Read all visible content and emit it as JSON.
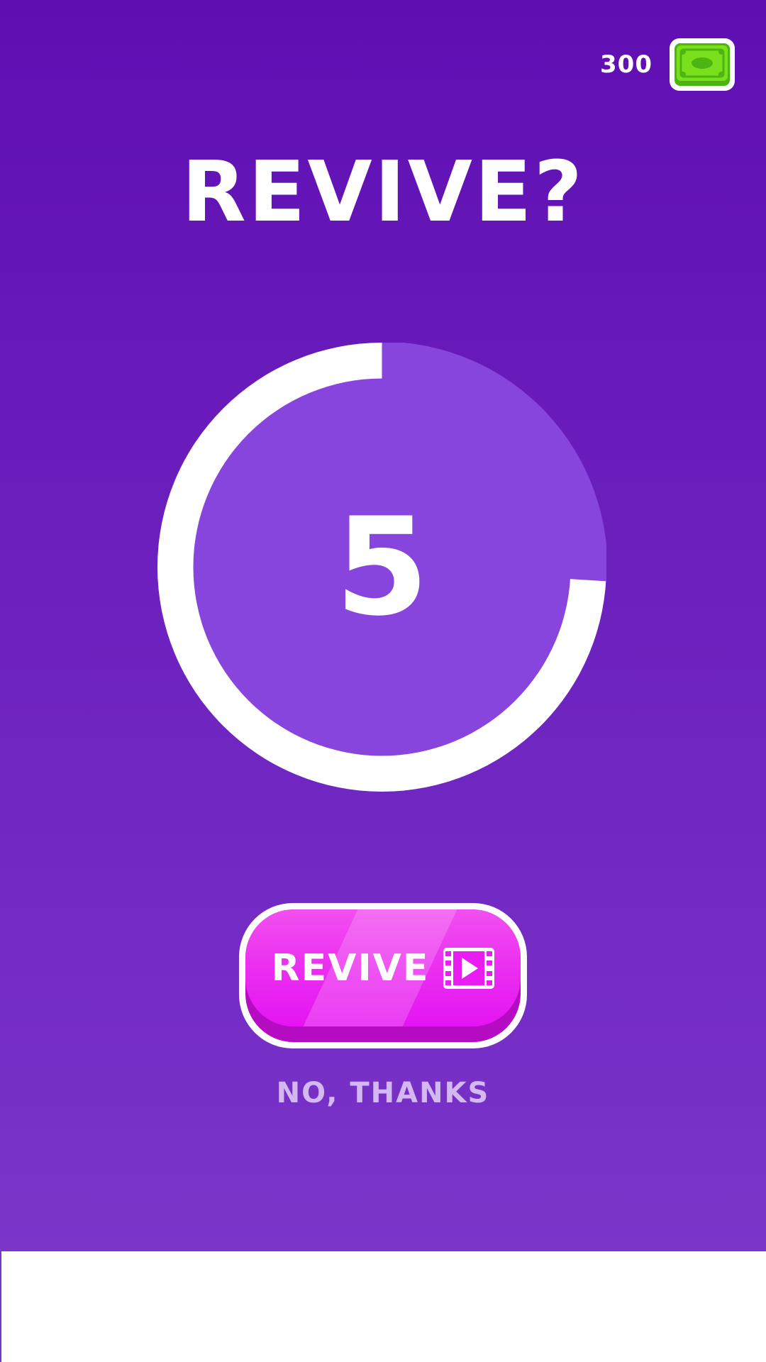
{
  "currency": {
    "amount": "300",
    "icon": "cash-icon",
    "icon_color": "#7be01c"
  },
  "title": "REVIVE?",
  "timer": {
    "value": "5",
    "remaining_fraction": 0.74,
    "ring_color": "#ffffff",
    "fill_color": "#8745dd"
  },
  "revive_button": {
    "label": "REVIVE",
    "icon": "video-ad-icon",
    "color": "#e514f3"
  },
  "decline": {
    "label": "NO, THANKS"
  },
  "colors": {
    "background_top": "#5f0eb2",
    "background_bottom": "#7a35c9"
  }
}
